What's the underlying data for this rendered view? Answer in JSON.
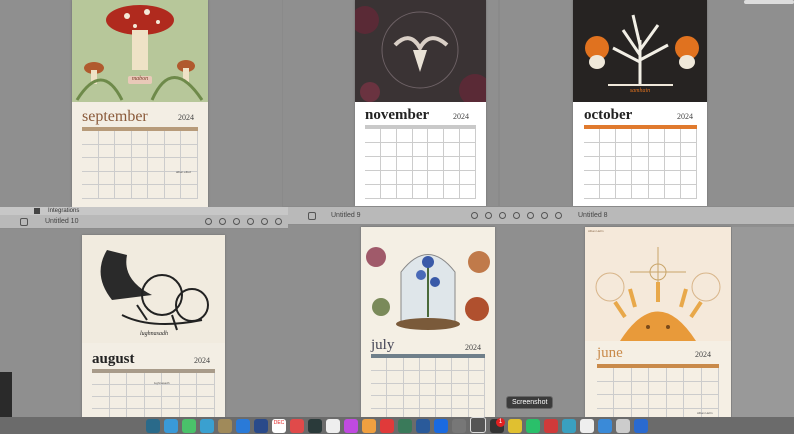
{
  "windows": {
    "integrations_tab": "Integrations",
    "bottom_left_title": "Untitled 10",
    "bottom_mid_title": "Untitled 9",
    "bottom_right_title": "Untitled 8"
  },
  "calendars": {
    "september": {
      "month": "september",
      "year": "2024",
      "caption": "mabon",
      "note": "alban elfed"
    },
    "november": {
      "month": "november",
      "year": "2024"
    },
    "october": {
      "month": "october",
      "year": "2024",
      "caption": "samhain"
    },
    "august": {
      "month": "august",
      "year": "2024",
      "caption": "lughnasadh",
      "note": "lughnasadh"
    },
    "july": {
      "month": "july",
      "year": "2024"
    },
    "june": {
      "month": "june",
      "year": "2024",
      "note": "Alban Hefin",
      "corner": "Alban Hefin"
    }
  },
  "dock": {
    "tooltip": "Screenshot",
    "badge": "1",
    "calendar_month": "DEC"
  },
  "colors": {
    "september_header": "#b79b7a",
    "october_header": "#e07a2e",
    "august_header": "#a89b8a",
    "july_header": "#6f7f8a",
    "june_header": "#c98a4a"
  }
}
